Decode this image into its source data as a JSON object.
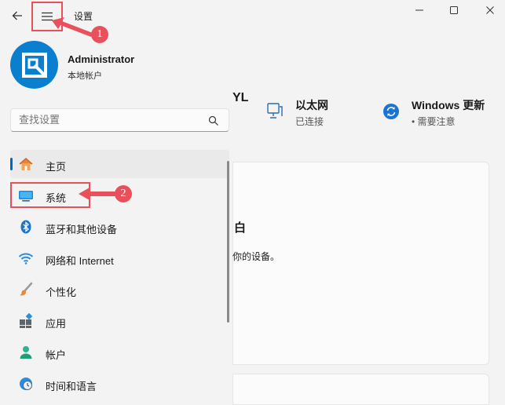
{
  "window": {
    "title": "设置"
  },
  "profile": {
    "name": "Administrator",
    "account_type": "本地帐户"
  },
  "search": {
    "placeholder": "查找设置"
  },
  "nav": {
    "items": [
      {
        "label": "主页",
        "icon": "home-icon"
      },
      {
        "label": "系统",
        "icon": "system-icon"
      },
      {
        "label": "蓝牙和其他设备",
        "icon": "bluetooth-icon"
      },
      {
        "label": "网络和 Internet",
        "icon": "wifi-icon"
      },
      {
        "label": "个性化",
        "icon": "brush-icon"
      },
      {
        "label": "应用",
        "icon": "apps-icon"
      },
      {
        "label": "帐户",
        "icon": "account-icon"
      },
      {
        "label": "时间和语言",
        "icon": "clock-globe-icon"
      }
    ]
  },
  "header": {
    "pc_name_partial": "YL",
    "ethernet": {
      "title": "以太网",
      "status": "已连接"
    },
    "windows_update": {
      "title": "Windows 更新",
      "status": "• 需要注意"
    }
  },
  "card": {
    "title_partial": "白",
    "desc_partial": "你的设备。"
  },
  "annotations": {
    "badge_1": "1",
    "badge_2": "2"
  },
  "colors": {
    "accent": "#0067c0",
    "annotation": "#e8505b",
    "avatar": "#0a7fd0"
  }
}
